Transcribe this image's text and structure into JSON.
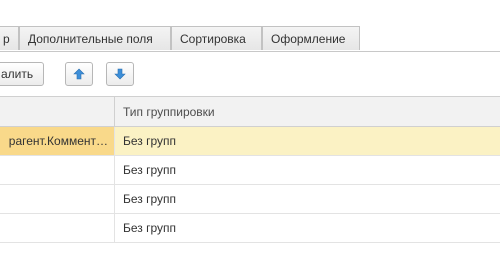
{
  "tabs": [
    {
      "label": "р"
    },
    {
      "label": "Дополнительные поля"
    },
    {
      "label": "Сортировка"
    },
    {
      "label": "Оформление"
    }
  ],
  "toolbar": {
    "delete_label": "алить",
    "move_up_icon": "arrow-up-icon",
    "move_down_icon": "arrow-down-icon",
    "accent_color": "#3d8fd9"
  },
  "table": {
    "column_header": "Тип группировки",
    "rows": [
      {
        "field": "рагент.Коммент…",
        "group_type": "Без групп",
        "selected": true
      },
      {
        "field": "",
        "group_type": "Без групп",
        "selected": false
      },
      {
        "field": "",
        "group_type": "Без групп",
        "selected": false
      },
      {
        "field": "",
        "group_type": "Без групп",
        "selected": false
      }
    ]
  }
}
